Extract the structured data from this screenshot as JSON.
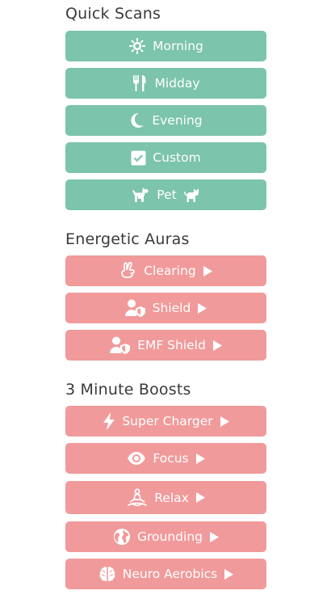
{
  "sections": {
    "quick_scans": {
      "title": "Quick Scans",
      "items": [
        {
          "label": "Morning",
          "icon": "sun-icon"
        },
        {
          "label": "Midday",
          "icon": "utensils-icon"
        },
        {
          "label": "Evening",
          "icon": "moon-icon"
        },
        {
          "label": "Custom",
          "icon": "checkbox-icon"
        },
        {
          "label": "Pet",
          "icon": "dog-icon",
          "icon_after": "cat-icon"
        }
      ]
    },
    "energetic_auras": {
      "title": "Energetic Auras",
      "items": [
        {
          "label": "Clearing",
          "icon": "peace-hand-icon"
        },
        {
          "label": "Shield",
          "icon": "user-shield-icon"
        },
        {
          "label": "EMF Shield",
          "icon": "user-shield-icon"
        }
      ]
    },
    "minute_boosts": {
      "title": "3 Minute Boosts",
      "items": [
        {
          "label": "Super Charger",
          "icon": "lightning-icon"
        },
        {
          "label": "Focus",
          "icon": "eye-icon"
        },
        {
          "label": "Relax",
          "icon": "meditation-icon"
        },
        {
          "label": "Grounding",
          "icon": "globe-icon"
        },
        {
          "label": "Neuro Aerobics",
          "icon": "brain-icon"
        }
      ]
    }
  },
  "colors": {
    "quick_scan_button": "#7cc4ab",
    "aura_button": "#f19a9b",
    "heading_text": "#3a3a3a",
    "button_text": "#ffffff"
  }
}
